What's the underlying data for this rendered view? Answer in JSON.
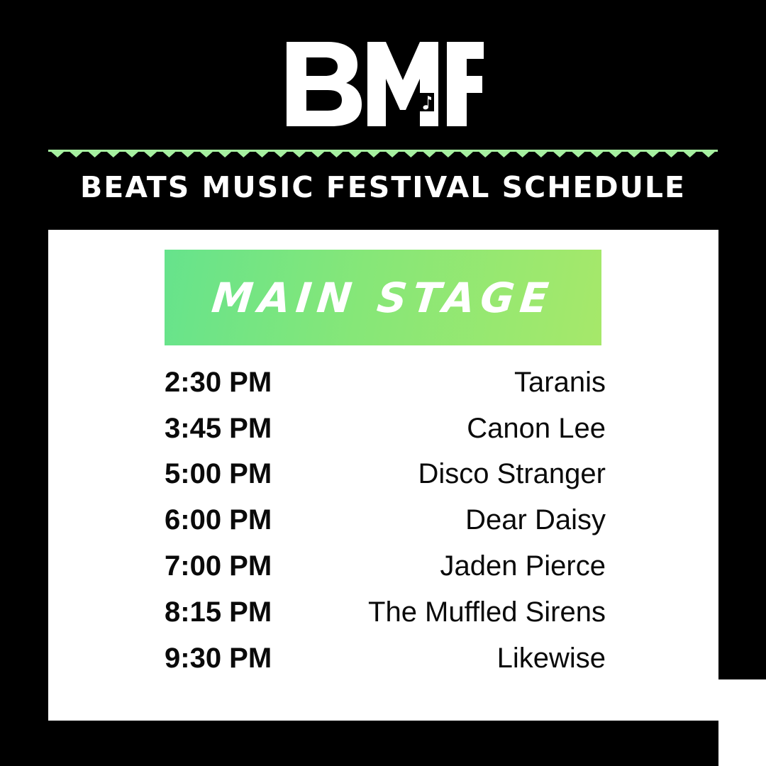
{
  "logo": {
    "text": "BMF",
    "icon": "music-note-icon"
  },
  "header": {
    "title": "BEATS MUSIC FESTIVAL SCHEDULE"
  },
  "divider": {
    "icon": "triangle-icon",
    "color": "#a6f0a0"
  },
  "stage": {
    "title": "MAIN STAGE",
    "gradient_start": "#66e38c",
    "gradient_end": "#a6e86a"
  },
  "schedule": [
    {
      "time": "2:30 PM",
      "artist": "Taranis"
    },
    {
      "time": "3:45 PM",
      "artist": "Canon Lee"
    },
    {
      "time": "5:00 PM",
      "artist": "Disco Stranger"
    },
    {
      "time": "6:00 PM",
      "artist": "Dear Daisy"
    },
    {
      "time": "7:00 PM",
      "artist": "Jaden Pierce"
    },
    {
      "time": "8:15 PM",
      "artist": "The Muffled Sirens"
    },
    {
      "time": "9:30 PM",
      "artist": "Likewise"
    }
  ],
  "colors": {
    "background": "#000000",
    "card": "#ffffff",
    "text": "#0a0a0a"
  }
}
